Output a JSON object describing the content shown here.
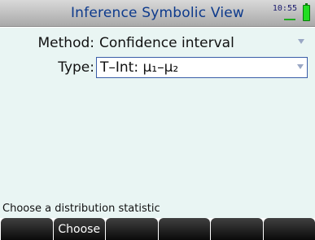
{
  "header": {
    "title": "Inference Symbolic View",
    "clock": "10:55"
  },
  "form": {
    "method": {
      "label": "Method:",
      "value": "Confidence interval"
    },
    "type": {
      "label": "Type:",
      "value": "T–Int: μ₁–μ₂"
    }
  },
  "status": {
    "prompt": "Choose a distribution statistic"
  },
  "menu": {
    "buttons": [
      "",
      "Choose",
      "",
      "",
      "",
      ""
    ]
  },
  "colors": {
    "title_text": "#0d3a8c",
    "content_bg": "#e9f5f3",
    "selected_border": "#3a5ea8",
    "menu_button": "#1a1a1a"
  }
}
